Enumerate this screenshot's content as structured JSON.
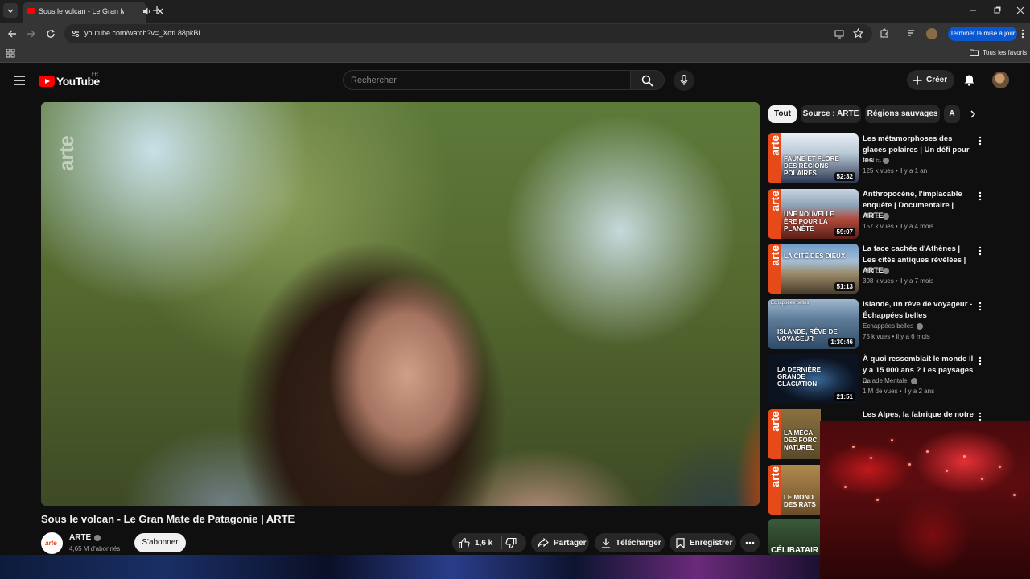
{
  "browser": {
    "tab_title": "Sous le volcan - Le Gran Mate de Patagonie | ARTE",
    "url": "youtube.com/watch?v=_XdtL88pkBI",
    "update_button": "Terminer la mise à jour",
    "bookmarks_all": "Tous les favoris"
  },
  "header": {
    "logo_text": "YouTube",
    "country": "FR",
    "search_placeholder": "Rechercher",
    "create_label": "Créer"
  },
  "video": {
    "watermark": "arte",
    "title": "Sous le volcan - Le Gran Mate de Patagonie | ARTE",
    "channel_name": "ARTE",
    "channel_logo_text": "arte",
    "subscribers": "4,65 M d'abonnés",
    "subscribe_label": "S'abonner",
    "likes": "1,6 k",
    "share_label": "Partager",
    "download_label": "Télécharger",
    "save_label": "Enregistrer"
  },
  "chips": [
    "Tout",
    "Source : ARTE",
    "Régions sauvages",
    "A"
  ],
  "recommendations": [
    {
      "title": "Les métamorphoses des glaces polaires | Un défi pour les ...",
      "channel": "ARTE",
      "meta": "125 k vues • il y a 1 an",
      "duration": "52:32",
      "thumb_text": "FAUNE ET FLORE DES RÉGIONS POLAIRES",
      "band_text": "arte"
    },
    {
      "title": "Anthropocène, l'implacable enquête | Documentaire | ARTE",
      "channel": "ARTE",
      "meta": "157 k vues • il y a 4 mois",
      "duration": "59:07",
      "thumb_text": "UNE NOUVELLE ÈRE POUR LA PLANÈTE",
      "band_text": "arte"
    },
    {
      "title": "La face cachée d'Athènes | Les cités antiques révélées | ARTE",
      "channel": "ARTE",
      "meta": "308 k vues • il y a 7 mois",
      "duration": "51:13",
      "thumb_text": "LA CITÉ DES DIEUX",
      "band_text": "arte"
    },
    {
      "title": "Islande, un rêve de voyageur - Échappées belles",
      "channel": "Echappées belles",
      "meta": "75 k vues • il y a 6 mois",
      "duration": "1:30:46",
      "thumb_text": "ISLANDE, RÊVE DE VOYAGEUR",
      "badge": "Echappées belles"
    },
    {
      "title": "À quoi ressemblait le monde il y a 15 000 ans ? Les paysages ...",
      "channel": "Balade Mentale",
      "meta": "1 M de vues • il y a 2 ans",
      "duration": "21:51",
      "thumb_text": "LA DERNIÈRE GRANDE GLACIATION"
    },
    {
      "title": "Les Alpes, la fabrique de notre",
      "thumb_text": "LA MÉCA DES FORC NATUREL",
      "band_text": "arte"
    },
    {
      "thumb_text": "LE MOND DES RATS",
      "band_text": "arte"
    },
    {
      "thumb_text": "CÉLIBATAIR"
    }
  ]
}
